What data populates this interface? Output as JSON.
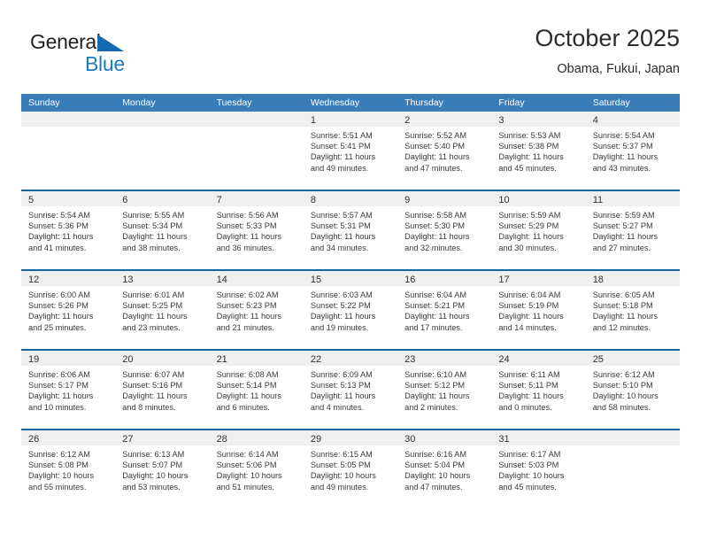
{
  "brand": {
    "name_part1": "General",
    "name_part2": "Blue",
    "triangle_color": "#1569b0",
    "blue_color": "#1a7bc4"
  },
  "header": {
    "title": "October 2025",
    "subtitle": "Obama, Fukui, Japan"
  },
  "theme": {
    "header_bar_color": "#3a7cb8",
    "week_divider_color": "#1b659e",
    "daynum_band_color": "#efefef"
  },
  "day_headers": [
    "Sunday",
    "Monday",
    "Tuesday",
    "Wednesday",
    "Thursday",
    "Friday",
    "Saturday"
  ],
  "weeks": [
    [
      {
        "day": "",
        "lines": []
      },
      {
        "day": "",
        "lines": []
      },
      {
        "day": "",
        "lines": []
      },
      {
        "day": "1",
        "lines": [
          "Sunrise: 5:51 AM",
          "Sunset: 5:41 PM",
          "Daylight: 11 hours",
          "and 49 minutes."
        ]
      },
      {
        "day": "2",
        "lines": [
          "Sunrise: 5:52 AM",
          "Sunset: 5:40 PM",
          "Daylight: 11 hours",
          "and 47 minutes."
        ]
      },
      {
        "day": "3",
        "lines": [
          "Sunrise: 5:53 AM",
          "Sunset: 5:38 PM",
          "Daylight: 11 hours",
          "and 45 minutes."
        ]
      },
      {
        "day": "4",
        "lines": [
          "Sunrise: 5:54 AM",
          "Sunset: 5:37 PM",
          "Daylight: 11 hours",
          "and 43 minutes."
        ]
      }
    ],
    [
      {
        "day": "5",
        "lines": [
          "Sunrise: 5:54 AM",
          "Sunset: 5:36 PM",
          "Daylight: 11 hours",
          "and 41 minutes."
        ]
      },
      {
        "day": "6",
        "lines": [
          "Sunrise: 5:55 AM",
          "Sunset: 5:34 PM",
          "Daylight: 11 hours",
          "and 38 minutes."
        ]
      },
      {
        "day": "7",
        "lines": [
          "Sunrise: 5:56 AM",
          "Sunset: 5:33 PM",
          "Daylight: 11 hours",
          "and 36 minutes."
        ]
      },
      {
        "day": "8",
        "lines": [
          "Sunrise: 5:57 AM",
          "Sunset: 5:31 PM",
          "Daylight: 11 hours",
          "and 34 minutes."
        ]
      },
      {
        "day": "9",
        "lines": [
          "Sunrise: 5:58 AM",
          "Sunset: 5:30 PM",
          "Daylight: 11 hours",
          "and 32 minutes."
        ]
      },
      {
        "day": "10",
        "lines": [
          "Sunrise: 5:59 AM",
          "Sunset: 5:29 PM",
          "Daylight: 11 hours",
          "and 30 minutes."
        ]
      },
      {
        "day": "11",
        "lines": [
          "Sunrise: 5:59 AM",
          "Sunset: 5:27 PM",
          "Daylight: 11 hours",
          "and 27 minutes."
        ]
      }
    ],
    [
      {
        "day": "12",
        "lines": [
          "Sunrise: 6:00 AM",
          "Sunset: 5:26 PM",
          "Daylight: 11 hours",
          "and 25 minutes."
        ]
      },
      {
        "day": "13",
        "lines": [
          "Sunrise: 6:01 AM",
          "Sunset: 5:25 PM",
          "Daylight: 11 hours",
          "and 23 minutes."
        ]
      },
      {
        "day": "14",
        "lines": [
          "Sunrise: 6:02 AM",
          "Sunset: 5:23 PM",
          "Daylight: 11 hours",
          "and 21 minutes."
        ]
      },
      {
        "day": "15",
        "lines": [
          "Sunrise: 6:03 AM",
          "Sunset: 5:22 PM",
          "Daylight: 11 hours",
          "and 19 minutes."
        ]
      },
      {
        "day": "16",
        "lines": [
          "Sunrise: 6:04 AM",
          "Sunset: 5:21 PM",
          "Daylight: 11 hours",
          "and 17 minutes."
        ]
      },
      {
        "day": "17",
        "lines": [
          "Sunrise: 6:04 AM",
          "Sunset: 5:19 PM",
          "Daylight: 11 hours",
          "and 14 minutes."
        ]
      },
      {
        "day": "18",
        "lines": [
          "Sunrise: 6:05 AM",
          "Sunset: 5:18 PM",
          "Daylight: 11 hours",
          "and 12 minutes."
        ]
      }
    ],
    [
      {
        "day": "19",
        "lines": [
          "Sunrise: 6:06 AM",
          "Sunset: 5:17 PM",
          "Daylight: 11 hours",
          "and 10 minutes."
        ]
      },
      {
        "day": "20",
        "lines": [
          "Sunrise: 6:07 AM",
          "Sunset: 5:16 PM",
          "Daylight: 11 hours",
          "and 8 minutes."
        ]
      },
      {
        "day": "21",
        "lines": [
          "Sunrise: 6:08 AM",
          "Sunset: 5:14 PM",
          "Daylight: 11 hours",
          "and 6 minutes."
        ]
      },
      {
        "day": "22",
        "lines": [
          "Sunrise: 6:09 AM",
          "Sunset: 5:13 PM",
          "Daylight: 11 hours",
          "and 4 minutes."
        ]
      },
      {
        "day": "23",
        "lines": [
          "Sunrise: 6:10 AM",
          "Sunset: 5:12 PM",
          "Daylight: 11 hours",
          "and 2 minutes."
        ]
      },
      {
        "day": "24",
        "lines": [
          "Sunrise: 6:11 AM",
          "Sunset: 5:11 PM",
          "Daylight: 11 hours",
          "and 0 minutes."
        ]
      },
      {
        "day": "25",
        "lines": [
          "Sunrise: 6:12 AM",
          "Sunset: 5:10 PM",
          "Daylight: 10 hours",
          "and 58 minutes."
        ]
      }
    ],
    [
      {
        "day": "26",
        "lines": [
          "Sunrise: 6:12 AM",
          "Sunset: 5:08 PM",
          "Daylight: 10 hours",
          "and 55 minutes."
        ]
      },
      {
        "day": "27",
        "lines": [
          "Sunrise: 6:13 AM",
          "Sunset: 5:07 PM",
          "Daylight: 10 hours",
          "and 53 minutes."
        ]
      },
      {
        "day": "28",
        "lines": [
          "Sunrise: 6:14 AM",
          "Sunset: 5:06 PM",
          "Daylight: 10 hours",
          "and 51 minutes."
        ]
      },
      {
        "day": "29",
        "lines": [
          "Sunrise: 6:15 AM",
          "Sunset: 5:05 PM",
          "Daylight: 10 hours",
          "and 49 minutes."
        ]
      },
      {
        "day": "30",
        "lines": [
          "Sunrise: 6:16 AM",
          "Sunset: 5:04 PM",
          "Daylight: 10 hours",
          "and 47 minutes."
        ]
      },
      {
        "day": "31",
        "lines": [
          "Sunrise: 6:17 AM",
          "Sunset: 5:03 PM",
          "Daylight: 10 hours",
          "and 45 minutes."
        ]
      },
      {
        "day": "",
        "lines": []
      }
    ]
  ]
}
